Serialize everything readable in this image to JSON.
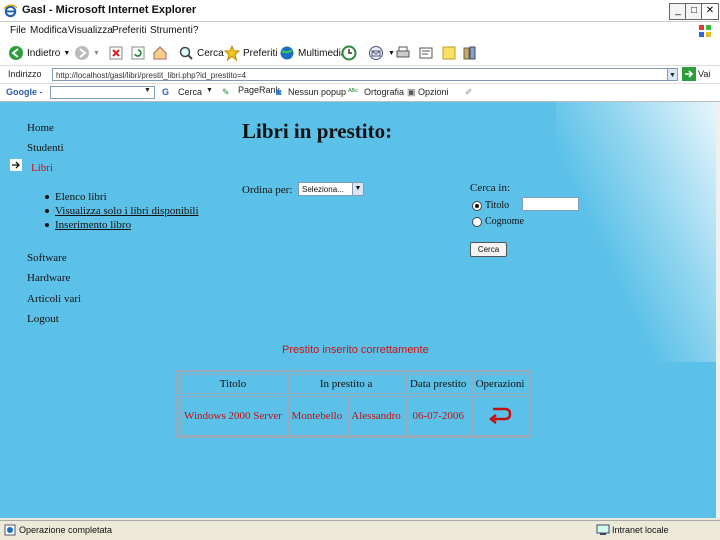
{
  "window": {
    "title": "Gasl - Microsoft Internet Explorer"
  },
  "menu": [
    "File",
    "Modifica",
    "Visualizza",
    "Preferiti",
    "Strumenti",
    "?"
  ],
  "toolbar": {
    "back": "Indietro",
    "search": "Cerca",
    "favorites": "Preferiti",
    "media": "Multimedia"
  },
  "address": {
    "label": "Indirizzo",
    "url": "http://localhost/gasl/libri/prestit_libri.php?id_prestito=4",
    "go": "Vai"
  },
  "googlebar": {
    "brand": "Google -",
    "search": "Cerca",
    "pagerank": "PageRank",
    "blocked": "Nessun popup",
    "spell": "Ortografia",
    "options": "Opzioni"
  },
  "nav": {
    "home": "Home",
    "studenti": "Studenti",
    "libri": "Libri",
    "sub": [
      "Elenco libri",
      "Visualizza solo i libri disponibili",
      "Inserimento libro"
    ],
    "software": "Software",
    "hardware": "Hardware",
    "articoli": "Articoli vari",
    "logout": "Logout"
  },
  "main": {
    "title": "Libri in prestito:",
    "sort_label": "Ordina per:",
    "sort_value": "Seleziona...",
    "search_label": "Cerca in:",
    "radio_titolo": "Titolo",
    "radio_cognome": "Cognome",
    "search_button": "Cerca",
    "message": "Prestito inserito correttamente",
    "table": {
      "headers": [
        "Titolo",
        "In prestito a",
        "",
        "Data prestito",
        "Operazioni"
      ],
      "rows": [
        [
          "Windows 2000 Server",
          "Montebello",
          "Alessandro",
          "06-07-2006"
        ]
      ]
    }
  },
  "status": {
    "left": "Operazione completata",
    "right": "Intranet locale"
  },
  "colors": {
    "content_bg": "#5cc1e8",
    "accent_red": "#d01010"
  }
}
